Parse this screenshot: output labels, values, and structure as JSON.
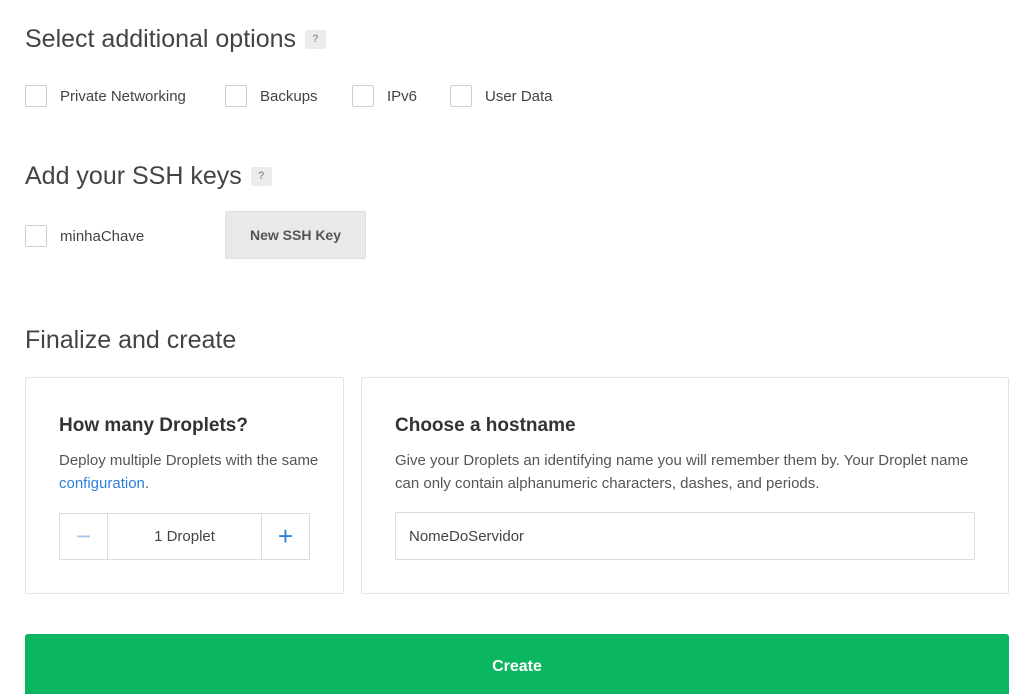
{
  "additional_options": {
    "title": "Select additional options",
    "help": "?",
    "options": [
      {
        "label": "Private Networking",
        "checked": false
      },
      {
        "label": "Backups",
        "checked": false
      },
      {
        "label": "IPv6",
        "checked": false
      },
      {
        "label": "User Data",
        "checked": false
      }
    ]
  },
  "ssh_keys": {
    "title": "Add your SSH keys",
    "help": "?",
    "keys": [
      {
        "label": "minhaChave",
        "checked": false
      }
    ],
    "new_key_button": "New SSH Key"
  },
  "finalize": {
    "title": "Finalize and create",
    "droplets_card": {
      "title": "How many Droplets?",
      "desc_prefix": "Deploy multiple Droplets with the same ",
      "desc_link": "configuration",
      "desc_suffix": ".",
      "minus": "−",
      "plus": "+",
      "value": "1 Droplet"
    },
    "hostname_card": {
      "title": "Choose a hostname",
      "desc": "Give your Droplets an identifying name you will remember them by. Your Droplet name can only contain alphanumeric characters, dashes, and periods.",
      "value": "NomeDoServidor"
    },
    "create_button": "Create"
  },
  "colors": {
    "accent": "#2f7ed8",
    "create": "#0bb661"
  }
}
